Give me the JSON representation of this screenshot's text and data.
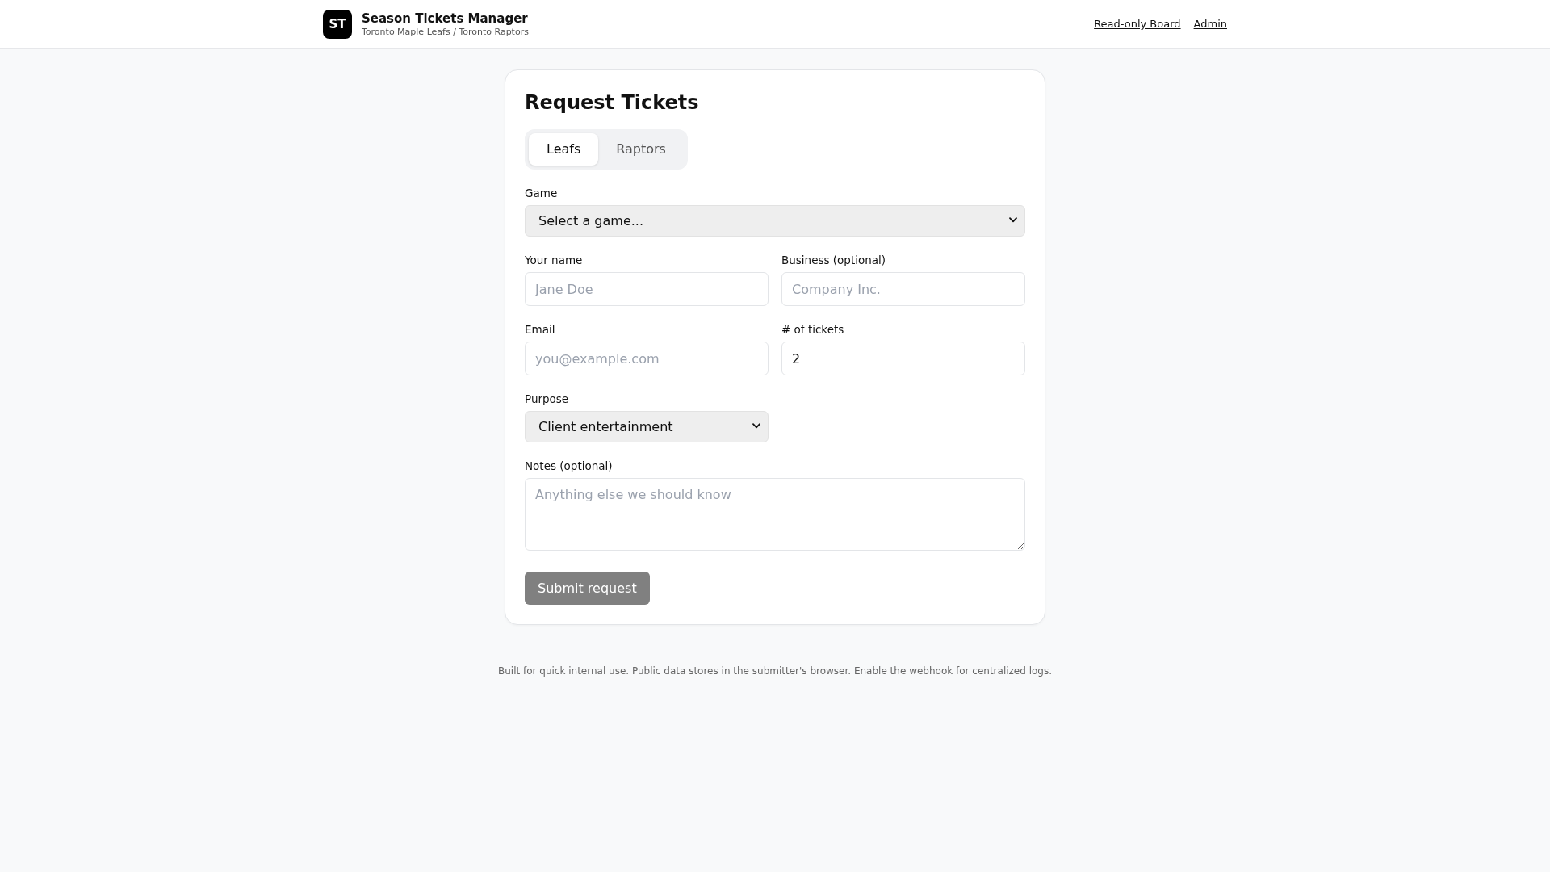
{
  "header": {
    "logo": "ST",
    "title": "Season Tickets Manager",
    "subtitle": "Toronto Maple Leafs / Toronto Raptors",
    "links": [
      "Read-only Board",
      "Admin"
    ]
  },
  "form": {
    "title": "Request Tickets",
    "tabs": [
      {
        "label": "Leafs",
        "selected": true
      },
      {
        "label": "Raptors",
        "selected": false
      }
    ],
    "game": {
      "label": "Game",
      "value": "Select a game..."
    },
    "name": {
      "label": "Your name",
      "placeholder": "Jane Doe"
    },
    "business": {
      "label": "Business (optional)",
      "placeholder": "Company Inc."
    },
    "email": {
      "label": "Email",
      "placeholder": "you@example.com"
    },
    "tickets": {
      "label": "# of tickets",
      "value": "2"
    },
    "purpose": {
      "label": "Purpose",
      "value": "Client entertainment"
    },
    "notes": {
      "label": "Notes (optional)",
      "placeholder": "Anything else we should know"
    },
    "submit": {
      "label": "Submit request",
      "disabled": true
    }
  },
  "footer": "Built for quick internal use. Public data stores in the submitter's browser. Enable the webhook for centralized logs."
}
